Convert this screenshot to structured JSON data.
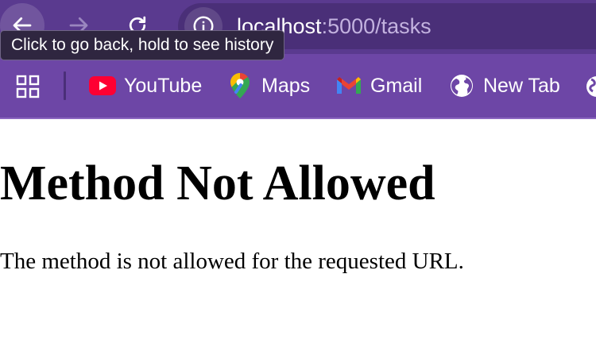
{
  "browser": {
    "url_host": "localhost",
    "url_path": ":5000/tasks",
    "tooltip": "Click to go back, hold to see history",
    "icons": {
      "back": "arrow-left-icon",
      "forward": "arrow-right-icon",
      "reload": "reload-icon",
      "site_info": "info-icon",
      "apps": "grid-icon"
    },
    "colors": {
      "toolbar": "#5a3a8f",
      "bookmarks_bar": "#6d46a6",
      "omnibox": "#4a2f78"
    }
  },
  "bookmarks": [
    {
      "label": "YouTube",
      "icon": "youtube-icon"
    },
    {
      "label": "Maps",
      "icon": "maps-pin-icon"
    },
    {
      "label": "Gmail",
      "icon": "gmail-icon"
    },
    {
      "label": "New Tab",
      "icon": "globe-icon"
    }
  ],
  "page": {
    "title": "Method Not Allowed",
    "message": "The method is not allowed for the requested URL."
  }
}
